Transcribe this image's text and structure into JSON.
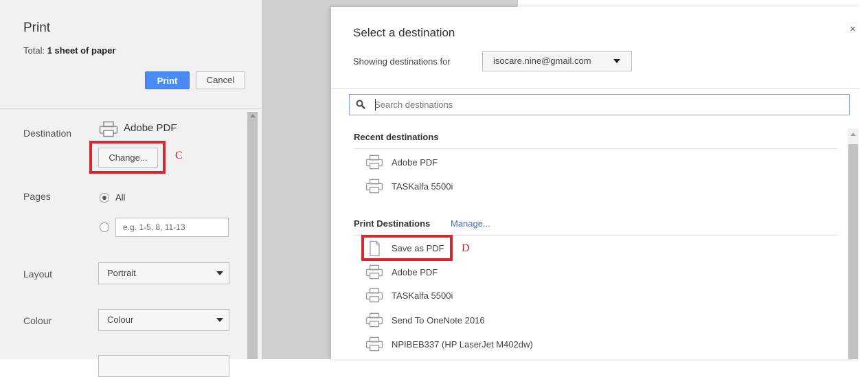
{
  "left_panel": {
    "title": "Print",
    "total_label": "Total:",
    "total_value": "1 sheet of paper",
    "print_button": "Print",
    "cancel_button": "Cancel",
    "destination_label": "Destination",
    "destination_name": "Adobe PDF",
    "change_button": "Change...",
    "marker_c": "C",
    "pages_label": "Pages",
    "pages_all": "All",
    "pages_custom_placeholder": "e.g. 1-5, 8, 11-13",
    "layout_label": "Layout",
    "layout_value": "Portrait",
    "colour_label": "Colour",
    "colour_value": "Colour"
  },
  "dialog": {
    "title": "Select a destination",
    "close": "×",
    "showing_label": "Showing destinations for",
    "account": "isocare.nine@gmail.com",
    "search_placeholder": "Search destinations",
    "recent_heading": "Recent destinations",
    "recent": [
      "Adobe PDF",
      "TASKalfa 5500i"
    ],
    "print_heading": "Print Destinations",
    "manage_link": "Manage...",
    "print_destinations": [
      "Save as PDF",
      "Adobe PDF",
      "TASKalfa 5500i",
      "Send To OneNote 2016",
      "NPIBEB337 (HP LaserJet M402dw)"
    ],
    "marker_d": "D"
  },
  "colors": {
    "accent": "#4a8af4",
    "highlight_box": "#d7262c",
    "link": "#3a6fc7"
  },
  "icons": {
    "printer": "printer-icon",
    "document": "document-icon",
    "search": "search-icon"
  }
}
